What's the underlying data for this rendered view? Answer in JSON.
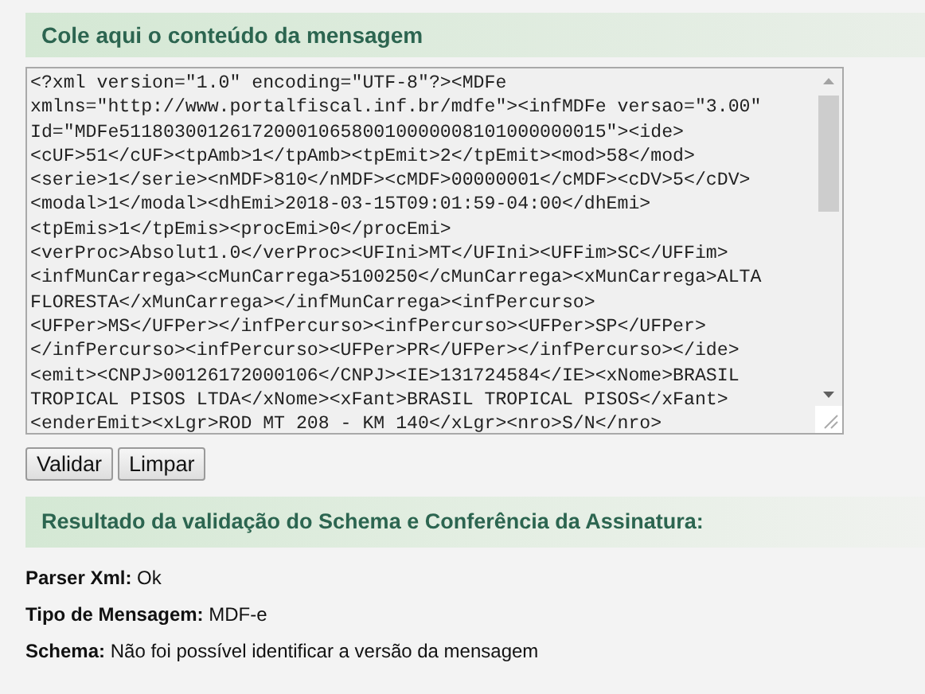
{
  "input_section": {
    "title": "Cole aqui o conteúdo da mensagem"
  },
  "xml_input": {
    "lines": [
      "<?xml version=\"1.0\" encoding=\"UTF-8\"?><MDFe",
      "xmlns=\"http://www.portalfiscal.inf.br/mdfe\"><infMDFe versao=\"3.00\"",
      "Id=\"MDFe51180300126172000106580010000008101000000015\"><ide>",
      "<cUF>51</cUF><tpAmb>1</tpAmb><tpEmit>2</tpEmit><mod>58</mod>",
      "<serie>1</serie><nMDF>810</nMDF><cMDF>00000001</cMDF><cDV>5</cDV>",
      "<modal>1</modal><dhEmi>2018-03-15T09:01:59-04:00</dhEmi>",
      "<tpEmis>1</tpEmis><procEmi>0</procEmi>",
      "<verProc>Absolut1.0</verProc><UFIni>MT</UFIni><UFFim>SC</UFFim>",
      "<infMunCarrega><cMunCarrega>5100250</cMunCarrega><xMunCarrega>ALTA",
      "FLORESTA</xMunCarrega></infMunCarrega><infPercurso>",
      "<UFPer>MS</UFPer></infPercurso><infPercurso><UFPer>SP</UFPer>",
      "</infPercurso><infPercurso><UFPer>PR</UFPer></infPercurso></ide>",
      "<emit><CNPJ>00126172000106</CNPJ><IE>131724584</IE><xNome>BRASIL",
      "TROPICAL PISOS LTDA</xNome><xFant>BRASIL TROPICAL PISOS</xFant>",
      "<enderEmit><xLgr>ROD MT 208 - KM 140</xLgr><nro>S/N</nro>"
    ]
  },
  "buttons": [
    {
      "label": "Validar"
    },
    {
      "label": "Limpar"
    }
  ],
  "result_section": {
    "title": "Resultado da validação do Schema e Conferência da Assinatura:"
  },
  "results": [
    {
      "label": "Parser Xml:",
      "value": "Ok"
    },
    {
      "label": "Tipo de Mensagem:",
      "value": "MDF-e"
    },
    {
      "label": "Schema:",
      "value": "Não foi possível identificar a versão da mensagem"
    }
  ]
}
